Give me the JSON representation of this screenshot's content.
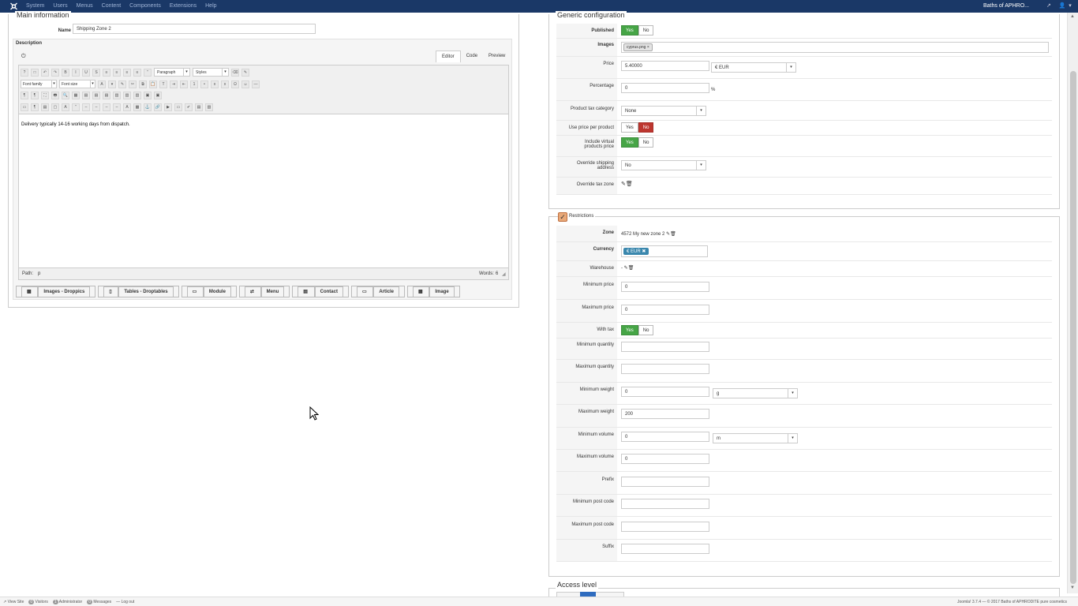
{
  "topbar": {
    "menu": [
      "System",
      "Users",
      "Menus",
      "Content",
      "Components",
      "Extensions",
      "Help"
    ],
    "site_name": "Baths of APHRO...",
    "user_icon": "user-icon"
  },
  "main_info": {
    "legend": "Main information",
    "name_label": "Name",
    "name_value": "Shipping Zone 2",
    "description_label": "Description",
    "tabs": [
      "Editor",
      "Code",
      "Preview"
    ],
    "active_tab": "Editor",
    "format_select": "Paragraph",
    "styles_select": "Styles",
    "font_family": "Font family",
    "font_size": "Font size",
    "content": "Delivery typically 14-16 working days from dispatch.",
    "path_label": "Path:",
    "path_value": "p",
    "words_label": "Words:",
    "words_value": "6",
    "buttons": [
      "Images - Droppics",
      "Tables - Droptables",
      "Module",
      "Menu",
      "Contact",
      "Article",
      "Image"
    ]
  },
  "generic": {
    "legend": "Generic configuration",
    "published_label": "Published",
    "images_label": "Images",
    "images_tag": "cyprus.png",
    "price_label": "Price",
    "price_value": "5.40000",
    "price_currency": "€ EUR",
    "percentage_label": "Percentage",
    "percentage_value": "0",
    "percentage_unit": "%",
    "tax_category_label": "Product tax category",
    "tax_category_value": "None",
    "use_price_label": "Use price per product",
    "include_virtual_label": "Include virtual products price",
    "override_address_label": "Override shipping address",
    "override_address_value": "No",
    "override_tax_label": "Override tax zone",
    "yes": "Yes",
    "no": "No"
  },
  "restrictions": {
    "legend": "Restrictions",
    "zone_label": "Zone",
    "zone_value": "4572 My new zone 2",
    "currency_label": "Currency",
    "currency_tag": "€ EUR",
    "warehouse_label": "Warehouse",
    "warehouse_value": "-",
    "min_price_label": "Minimum price",
    "min_price_value": "0",
    "max_price_label": "Maximum price",
    "max_price_value": "0",
    "with_tax_label": "With tax",
    "min_qty_label": "Minimum quantity",
    "max_qty_label": "Maximum quantity",
    "min_weight_label": "Minimum weight",
    "min_weight_value": "0",
    "weight_unit": "g",
    "max_weight_label": "Maximum weight",
    "max_weight_value": "200",
    "min_volume_label": "Minimum volume",
    "min_volume_value": "0",
    "volume_unit": "m",
    "max_volume_label": "Maximum volume",
    "max_volume_value": "0",
    "prefix_label": "Prefix",
    "min_post_label": "Minimum post code",
    "max_post_label": "Maximum post code",
    "suffix_label": "Suffix"
  },
  "access": {
    "legend": "Access level"
  },
  "status": {
    "view_site": "View Site",
    "visitors_count": "0",
    "visitors": "Visitors",
    "admin_count": "1",
    "admin": "Administrator",
    "messages_count": "0",
    "messages": "Messages",
    "logout": "Log out",
    "right": "Joomla! 3.7.4 — © 2017 Baths of APHRODITE pure cosmetics"
  }
}
